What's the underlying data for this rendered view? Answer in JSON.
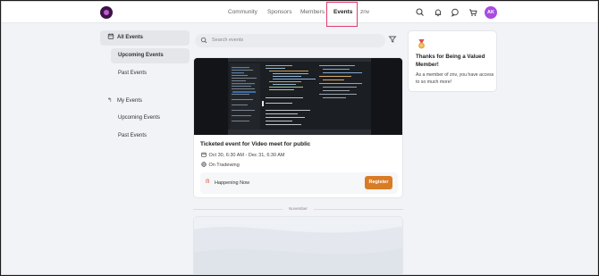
{
  "header": {
    "nav": [
      {
        "label": "Community",
        "active": false
      },
      {
        "label": "Sponsors",
        "active": false
      },
      {
        "label": "Members",
        "active": false
      },
      {
        "label": "Events",
        "active": true
      },
      {
        "label": "znv",
        "active": false
      }
    ],
    "avatar_initials": "AK",
    "icons": [
      "search-icon",
      "bell-icon",
      "chat-icon",
      "cart-icon"
    ]
  },
  "sidebar": {
    "all_events": {
      "label": "All Events",
      "icon": "calendar-icon"
    },
    "all_sub": [
      {
        "label": "Upcoming Events",
        "active": true
      },
      {
        "label": "Past Events",
        "active": false
      }
    ],
    "my_events": {
      "label": "My Events",
      "icon": "reply-arrow-icon"
    },
    "my_sub": [
      {
        "label": "Upcoming Events",
        "active": false
      },
      {
        "label": "Past Events",
        "active": false
      }
    ]
  },
  "search": {
    "placeholder": "Search events"
  },
  "event": {
    "title": "Ticketed event for Video meet for public",
    "date": "Oct 30, 6:30 AM - Dec 31, 6:30 AM",
    "location": "On Tradewing",
    "status": "Happening Now",
    "register_label": "Register"
  },
  "divider": {
    "month": "November"
  },
  "member_card": {
    "title": "Thanks for Being a Valued Member!",
    "body": "As a member of znv, you have access to so much more!"
  },
  "colors": {
    "accent": "#d97c26",
    "highlight": "#e23a6d",
    "avatar": "#a84ce0"
  }
}
